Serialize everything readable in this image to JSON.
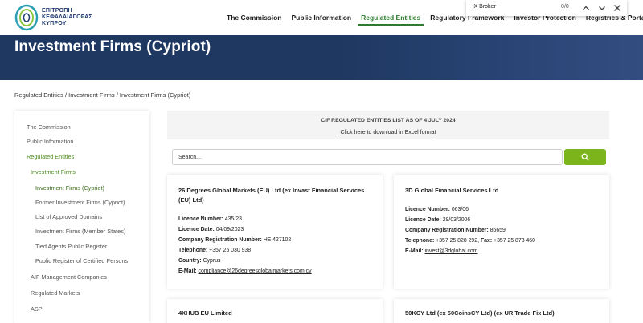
{
  "header": {
    "logo_line1": "ΕΠΙΤΡΟΠΗ",
    "logo_line2": "ΚΕΦΑΛΑΙΑΓΟΡΑΣ",
    "logo_line3": "ΚΥΠΡΟΥ",
    "nav": [
      {
        "label": "The Commission"
      },
      {
        "label": "Public Information"
      },
      {
        "label": "Regulated Entities"
      },
      {
        "label": "Regulatory Framework"
      },
      {
        "label": "Investor Protection"
      },
      {
        "label": "Registries & Portals"
      }
    ]
  },
  "findbar": {
    "query": "iX Broker",
    "count": "0/0"
  },
  "banner": {
    "title": "Investment Firms (Cypriot)"
  },
  "breadcrumb": "Regulated Entities / Investment Firms / Investment Firms (Cypriot)",
  "sidebar": {
    "items": [
      {
        "label": "The Commission"
      },
      {
        "label": "Public Information"
      },
      {
        "label": "Regulated Entities"
      },
      {
        "label": "Investment Firms"
      },
      {
        "label": "Investment Firms (Cypriot)"
      },
      {
        "label": "Former Investment Firms (Cypriot)"
      },
      {
        "label": "List of Approved Domains"
      },
      {
        "label": "Investment Firms (Member States)"
      },
      {
        "label": "Tied Agents Public Register"
      },
      {
        "label": "Public Register of Certified Persons"
      },
      {
        "label": "AIF Management Companies"
      },
      {
        "label": "Regulated Markets"
      },
      {
        "label": "ASP"
      }
    ]
  },
  "notice": {
    "title": "CIF REGULATED ENTITIES LIST AS OF 4 JULY 2024",
    "link": "Click here to download in Excel format"
  },
  "search": {
    "placeholder": "Search..."
  },
  "cards": [
    {
      "name_line1": "26 Degrees Global Markets (EU) Ltd (ex Invast Financial Services",
      "name_line2": "(EU) Ltd)",
      "licence_label": "Licence Number:",
      "licence": "435/23",
      "date_label": "Licence Date:",
      "date": "04/09/2023",
      "reg_label": "Company Registration Number:",
      "reg": "HE 427102",
      "phone_label": "Telephone:",
      "phone": "+357 25 030 938",
      "country_label": "Country:",
      "country": "Cyprus",
      "email_label": "E-Mail:",
      "email": "compliance@26degreesglobalmarkets.com.cy"
    },
    {
      "name_line1": "3D Global Financial Services Ltd",
      "licence_label": "Licence Number:",
      "licence": "063/06",
      "date_label": "Licence Date:",
      "date": "29/03/2006",
      "reg_label": "Company Registration Number:",
      "reg": "86659",
      "phone_label": "Telephone:",
      "phone": "+357 25 828 292",
      "fax_label": "Fax:",
      "fax": "+357 25 873 460",
      "email_label": "E-Mail:",
      "email": "invest@3dglobal.com"
    },
    {
      "name_line1": "4XHUB EU Limited"
    },
    {
      "name_line1": "50KCY Ltd (ex 50CoinsCY Ltd) (ex UR Trade Fix Ltd)"
    }
  ],
  "colors": {
    "banner": "#1f3862",
    "accent_green": "#2f7a31",
    "search_button": "#7cb51b"
  }
}
